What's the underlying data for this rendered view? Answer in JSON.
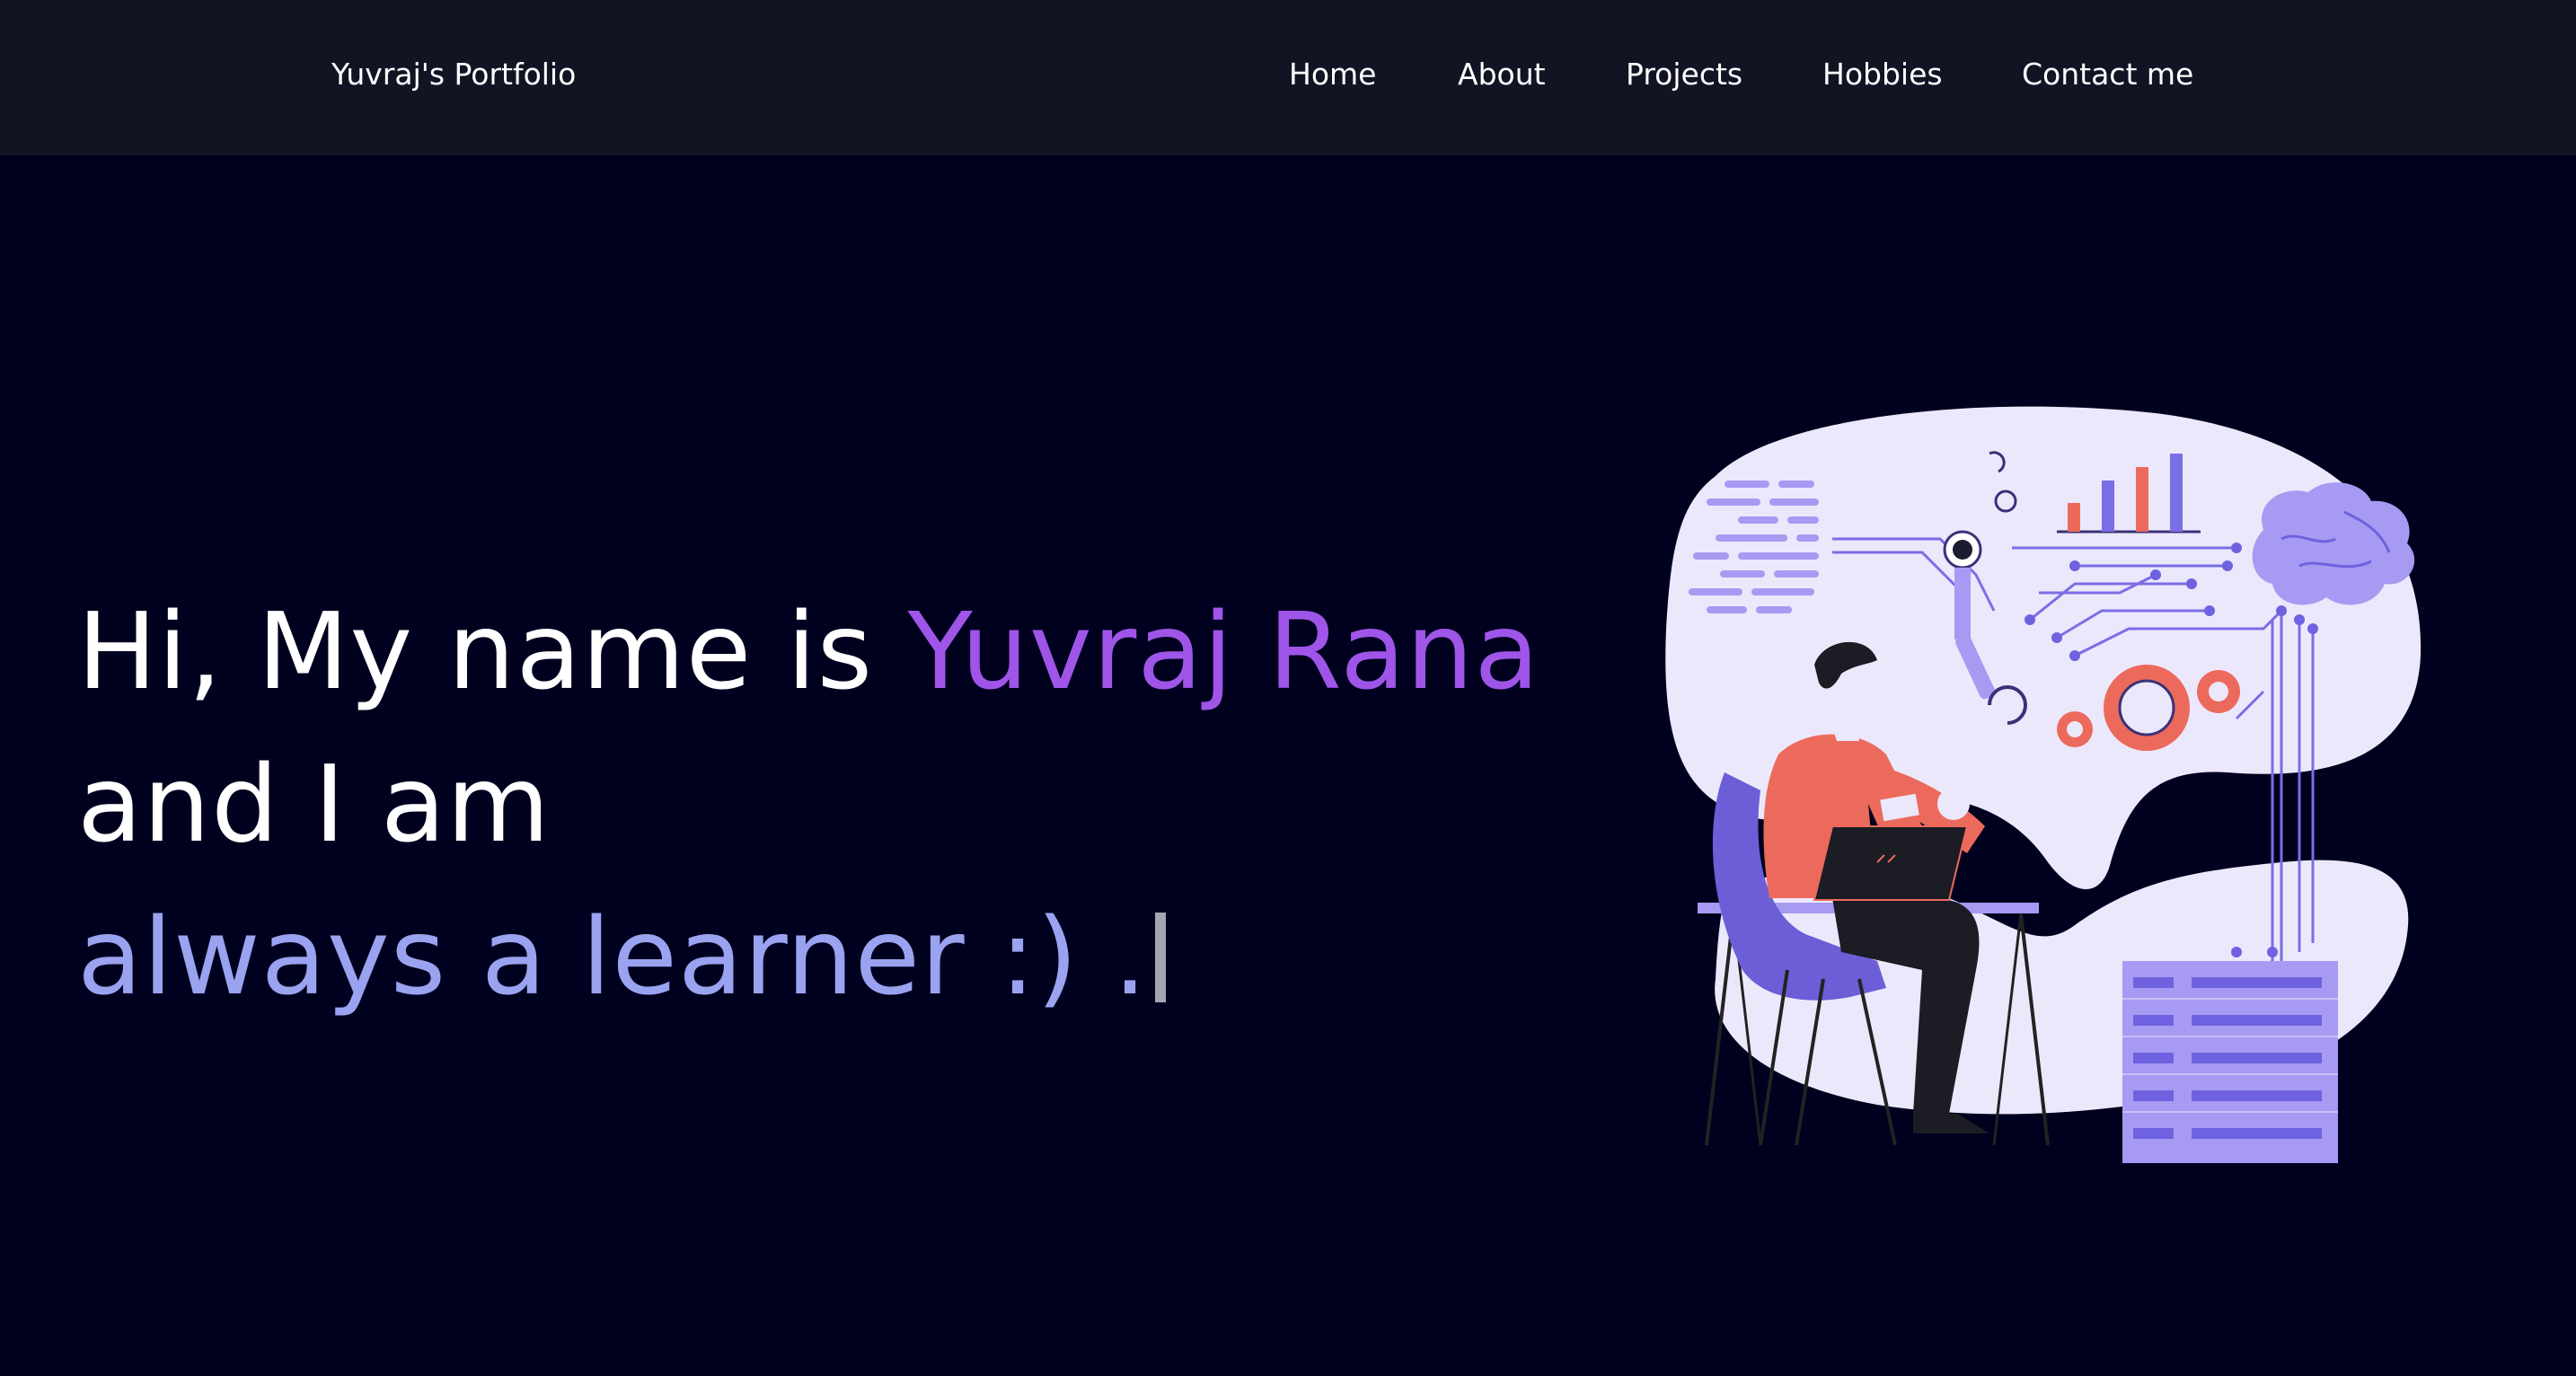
{
  "navbar": {
    "brand": "Yuvraj's Portfolio",
    "links": [
      "Home",
      "About",
      "Projects",
      "Hobbies",
      "Contact me"
    ]
  },
  "hero": {
    "line1_prefix": "Hi, My name is ",
    "line1_name": "Yuvraj Rana",
    "line2": "and I am",
    "typed_text": "always a learner :) ."
  },
  "colors": {
    "page_background": "#00001f",
    "navbar_background": "#121424",
    "name_accent": "#9f55e8",
    "typed_accent": "#9aa3f0",
    "illustration_blob": "#ece8fc",
    "illustration_purple": "#8e7ff0",
    "illustration_coral": "#ec6a5c"
  },
  "illustration": {
    "icon": "developer-at-laptop-illustration"
  }
}
